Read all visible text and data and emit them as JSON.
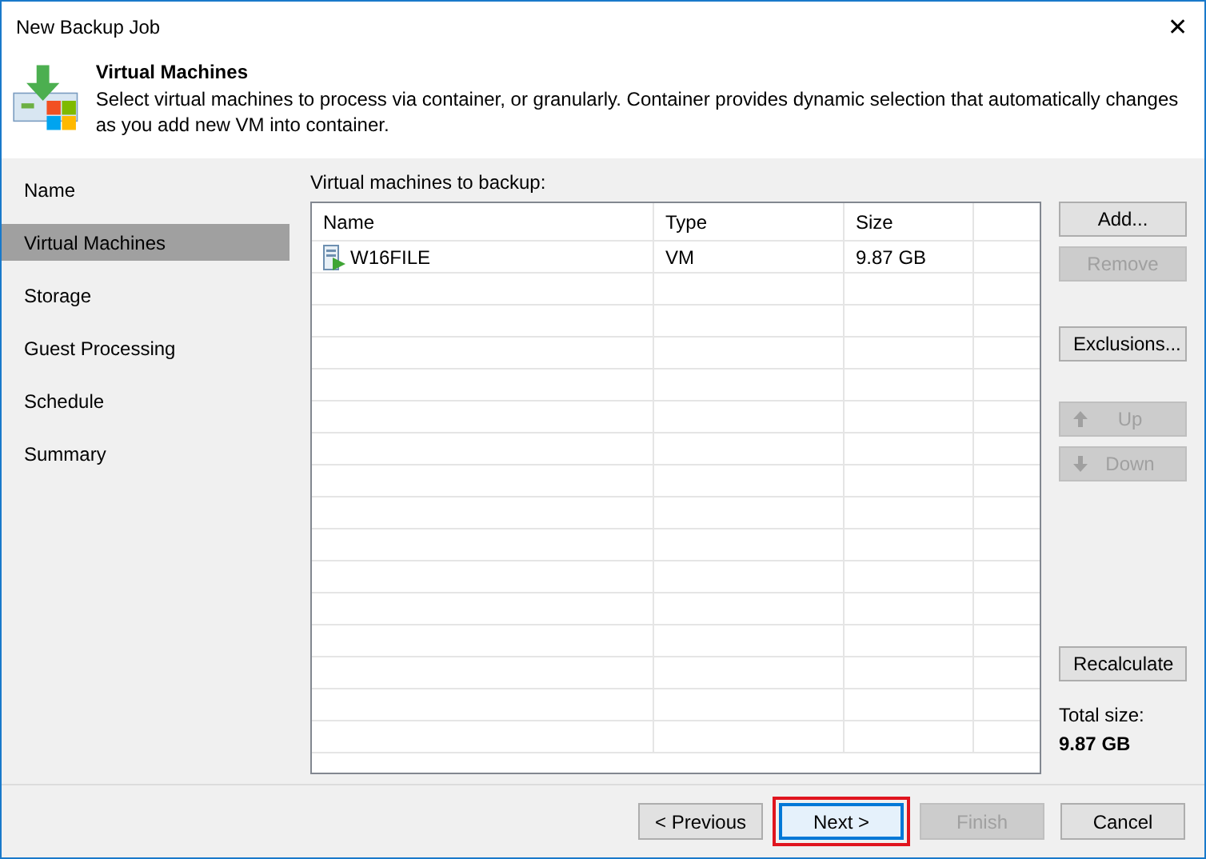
{
  "window": {
    "title": "New Backup Job",
    "close": "✕"
  },
  "header": {
    "title": "Virtual Machines",
    "description": "Select virtual machines to process via container, or granularly. Container provides dynamic selection that automatically changes as you add new VM into container."
  },
  "sidebar": {
    "items": [
      {
        "label": "Name",
        "selected": false
      },
      {
        "label": "Virtual Machines",
        "selected": true
      },
      {
        "label": "Storage",
        "selected": false
      },
      {
        "label": "Guest Processing",
        "selected": false
      },
      {
        "label": "Schedule",
        "selected": false
      },
      {
        "label": "Summary",
        "selected": false
      }
    ]
  },
  "table": {
    "label": "Virtual machines to backup:",
    "columns": [
      "Name",
      "Type",
      "Size"
    ],
    "rows": [
      {
        "name": "W16FILE",
        "type": "VM",
        "size": "9.87 GB"
      }
    ]
  },
  "side_buttons": [
    {
      "label": "Add...",
      "disabled": false,
      "kind": "plain"
    },
    {
      "label": "Remove",
      "disabled": true,
      "kind": "plain"
    },
    {
      "label": "Exclusions...",
      "disabled": false,
      "kind": "plain"
    },
    {
      "label": "Up",
      "disabled": true,
      "kind": "up"
    },
    {
      "label": "Down",
      "disabled": true,
      "kind": "down"
    },
    {
      "label": "Recalculate",
      "disabled": false,
      "kind": "plain"
    }
  ],
  "total": {
    "label": "Total size:",
    "value": "9.87 GB"
  },
  "footer_buttons": [
    {
      "label": "< Previous",
      "disabled": false,
      "default": false,
      "highlighted": false
    },
    {
      "label": "Next >",
      "disabled": false,
      "default": true,
      "highlighted": true
    },
    {
      "label": "Finish",
      "disabled": true,
      "default": false,
      "highlighted": false
    },
    {
      "label": "Cancel",
      "disabled": false,
      "default": false,
      "highlighted": false
    }
  ]
}
